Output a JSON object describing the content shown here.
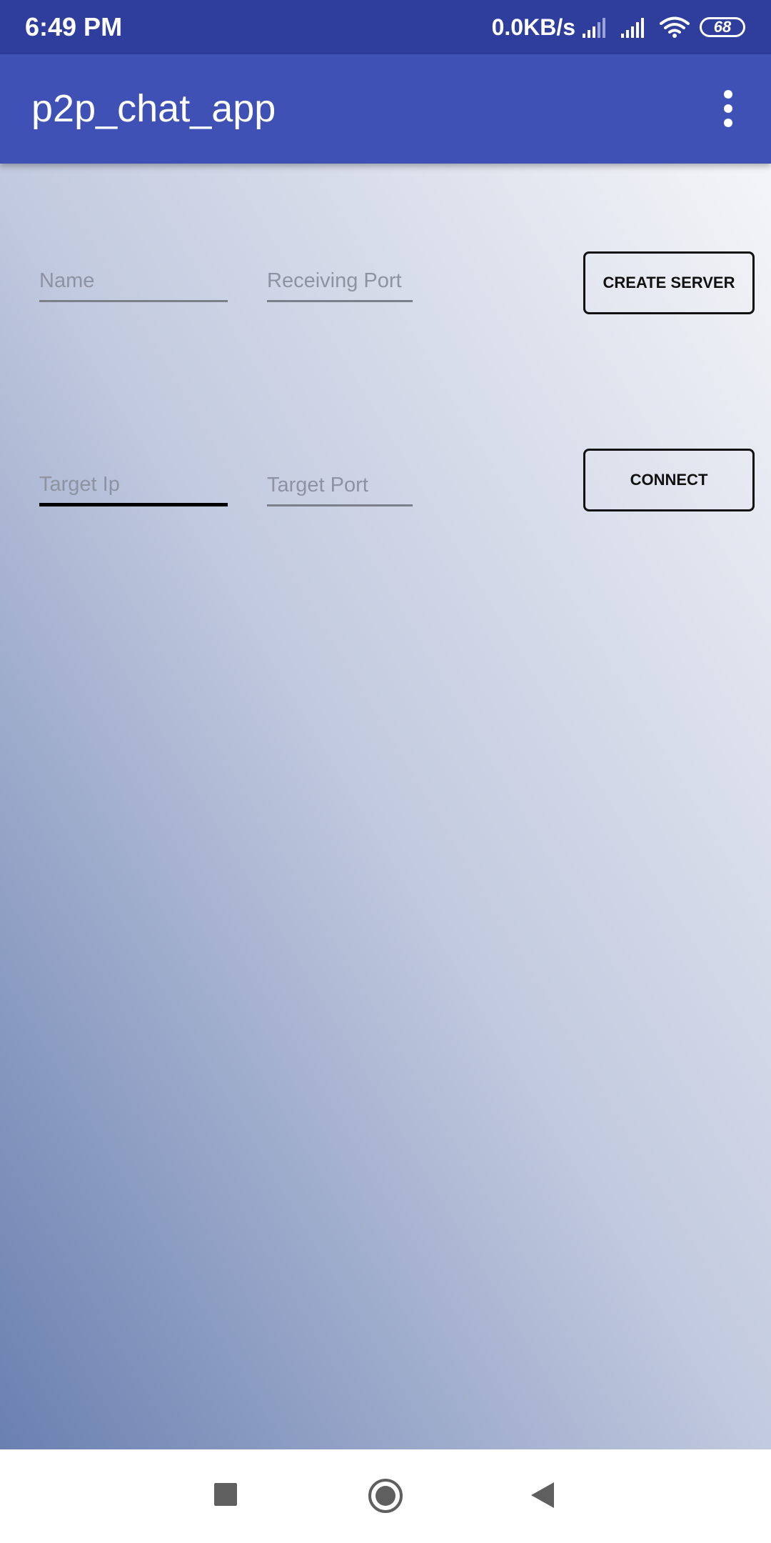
{
  "status_bar": {
    "time": "6:49 PM",
    "net_speed": "0.0KB/s",
    "battery_level": "68",
    "icons": [
      "signal-icon",
      "signal-icon",
      "wifi-icon",
      "battery-icon"
    ]
  },
  "app_bar": {
    "title": "p2p_chat_app",
    "overflow_icon": "more-vert-icon"
  },
  "form": {
    "name": {
      "placeholder": "Name",
      "value": ""
    },
    "receiving_port": {
      "placeholder": "Receiving Port",
      "value": ""
    },
    "create_server_label": "CREATE SERVER",
    "target_ip": {
      "placeholder": "Target Ip",
      "value": ""
    },
    "target_port": {
      "placeholder": "Target Port",
      "value": ""
    },
    "connect_label": "CONNECT"
  },
  "nav_bar": {
    "icons": [
      "recents-icon",
      "home-icon",
      "back-icon"
    ]
  },
  "colors": {
    "status_bar": "#2f3d9c",
    "app_bar": "#3f51b5",
    "gradient_dark": "#6a80b0",
    "gradient_light": "#f4f5f8"
  }
}
